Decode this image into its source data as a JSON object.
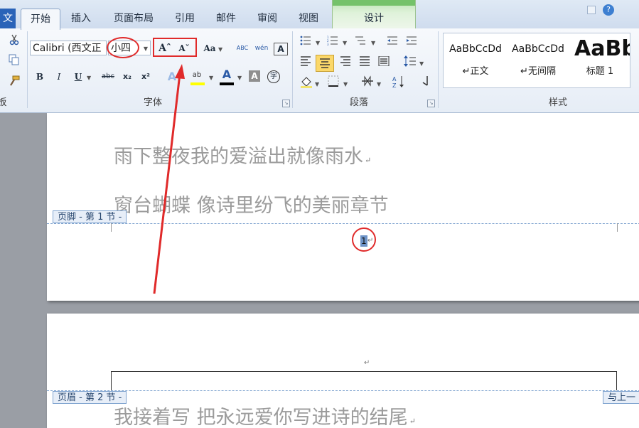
{
  "tabs": {
    "file": "文",
    "home": "开始",
    "insert": "插入",
    "layout": "页面布局",
    "references": "引用",
    "mailings": "邮件",
    "review": "审阅",
    "view": "视图",
    "design": "设计"
  },
  "ribbon": {
    "clipboard": {
      "label_fragment": "板",
      "cut_icon": "scissors-icon",
      "copy_icon": "copy-icon",
      "format_painter_icon": "format-painter-icon"
    },
    "font": {
      "group_label": "字体",
      "font_name": "Calibri (西文正",
      "font_size": "小四",
      "grow_label": "Aˆ",
      "shrink_label": "Aˇ",
      "change_case_label": "Aa",
      "clear_format_label": "ABC",
      "phonetic_label": "wén",
      "border_label": "A",
      "bold": "B",
      "italic": "I",
      "underline": "U",
      "strike": "abc",
      "subscript": "x₂",
      "superscript": "x²",
      "effects_label": "A",
      "highlight_label": "ab",
      "color_label": "A",
      "shading_label": "A",
      "enclose_label": "字",
      "highlight_color": "#ffff00",
      "font_color": "#000000"
    },
    "paragraph": {
      "group_label": "段落"
    },
    "styles": {
      "group_label": "样式",
      "items": [
        {
          "preview": "AaBbCcDd",
          "name": "↵正文"
        },
        {
          "preview": "AaBbCcDd",
          "name": "↵无间隔"
        },
        {
          "preview": "AaBb",
          "name": "标题 1"
        }
      ]
    }
  },
  "document": {
    "page1_lines": [
      "雨下整夜我的爱溢出就像雨水",
      "窗台蝴蝶  像诗里纷飞的美丽章节"
    ],
    "footer_tag": "页脚 - 第 1 节 -",
    "page_number": "1",
    "header_tag": "页眉 - 第 2 节 -",
    "link_tag": "与上一",
    "page2_line": "我接着写  把永远爱你写进诗的结尾",
    "para_mark": "↵"
  },
  "annotation_color": "#e02a2a"
}
